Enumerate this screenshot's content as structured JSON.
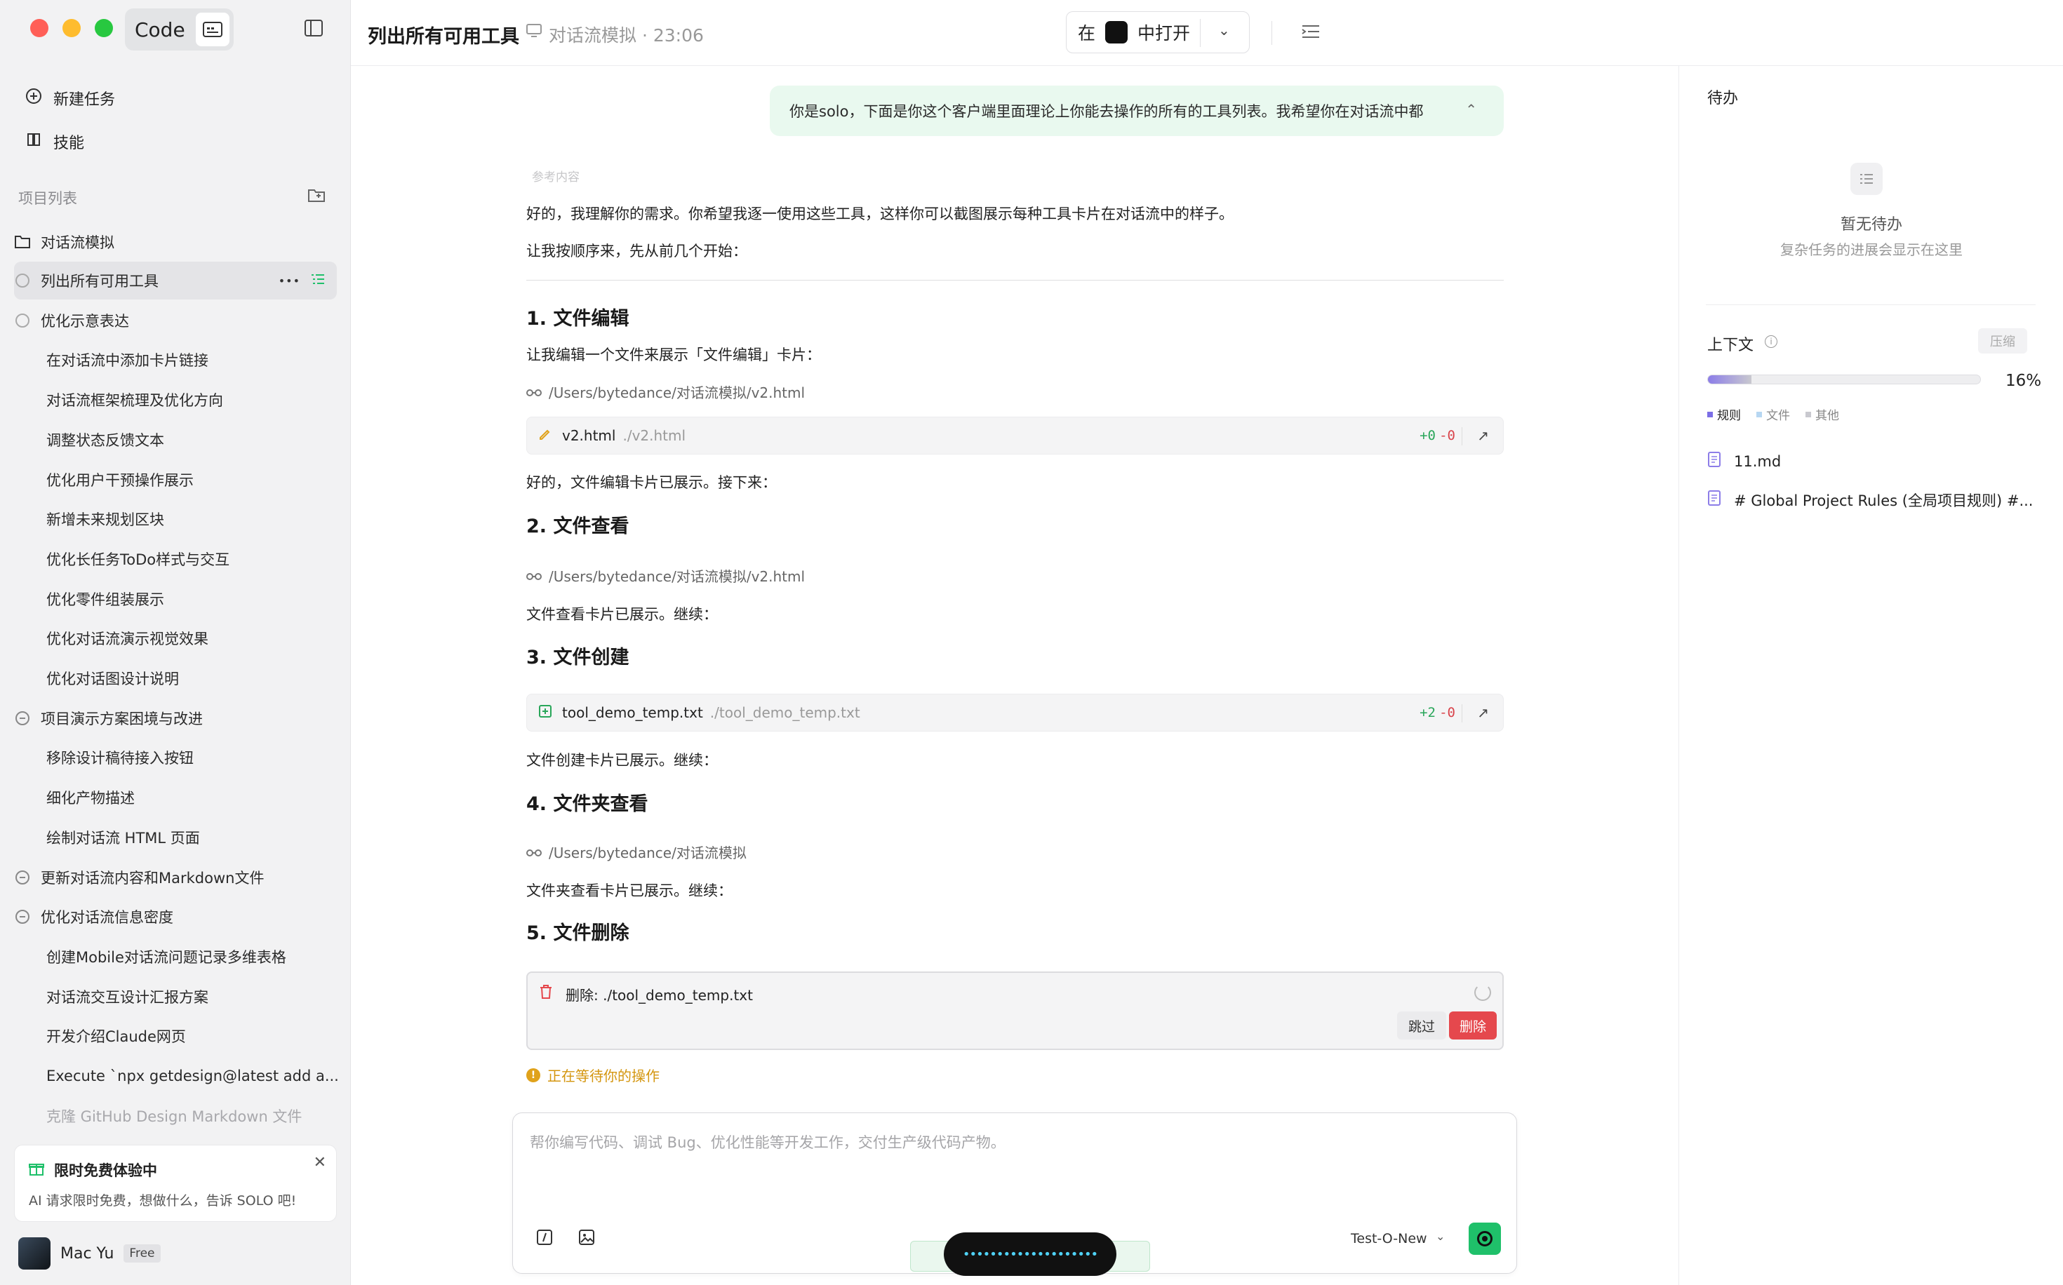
{
  "window": {
    "app_name": "Code"
  },
  "sidebar": {
    "new_task": "新建任务",
    "skills": "技能",
    "projects_label": "项目列表",
    "project_name": "对话流模拟",
    "tasks": [
      {
        "label": "列出所有可用工具",
        "type": "spinner",
        "active": true
      },
      {
        "label": "优化示意表达",
        "type": "spinner"
      },
      {
        "label": "在对话流中添加卡片链接",
        "type": "child"
      },
      {
        "label": "对话流框架梳理及优化方向",
        "type": "child"
      },
      {
        "label": "调整状态反馈文本",
        "type": "child"
      },
      {
        "label": "优化用户干预操作展示",
        "type": "child"
      },
      {
        "label": "新增未来规划区块",
        "type": "child"
      },
      {
        "label": "优化长任务ToDo样式与交互",
        "type": "child"
      },
      {
        "label": "优化零件组装展示",
        "type": "child"
      },
      {
        "label": "优化对话流演示视觉效果",
        "type": "child"
      },
      {
        "label": "优化对话图设计说明",
        "type": "child"
      },
      {
        "label": "项目演示方案困境与改进",
        "type": "group"
      },
      {
        "label": "移除设计稿待接入按钮",
        "type": "child"
      },
      {
        "label": "细化产物描述",
        "type": "child"
      },
      {
        "label": "绘制对话流 HTML 页面",
        "type": "child"
      },
      {
        "label": "更新对话流内容和Markdown文件",
        "type": "group"
      },
      {
        "label": "优化对话流信息密度",
        "type": "group"
      },
      {
        "label": "创建Mobile对话流问题记录多维表格",
        "type": "child"
      },
      {
        "label": "对话流交互设计汇报方案",
        "type": "child"
      },
      {
        "label": "开发介绍Claude网页",
        "type": "child"
      },
      {
        "label": "Execute `npx getdesign@latest add a...",
        "type": "child"
      },
      {
        "label": "克隆 GitHub Design Markdown 文件",
        "type": "child-faded"
      }
    ],
    "promo": {
      "title": "限时免费体验中",
      "desc": "AI 请求限时免费，想做什么，告诉 SOLO 吧!"
    },
    "user": {
      "name": "Mac Yu",
      "plan": "Free"
    }
  },
  "header": {
    "title": "列出所有可用工具",
    "meta": "对话流模拟 · 23:06",
    "open_in_prefix": "在",
    "open_in_suffix": "中打开"
  },
  "chat": {
    "user_message": "你是solo，下面是你这个客户端里面理论上你能去操作的所有的工具列表。我希望你在对话流中都",
    "ref_label": "参考内容",
    "intro1": "好的，我理解你的需求。你希望我逐一使用这些工具，这样你可以截图展示每种工具卡片在对话流中的样子。",
    "intro2": "让我按顺序来，先从前几个开始：",
    "s1_title": "1. 文件编辑",
    "s1_desc": "让我编辑一个文件来展示「文件编辑」卡片：",
    "s1_path": "/Users/bytedance/对话流模拟/v2.html",
    "s1_card": {
      "name": "v2.html",
      "path": "./v2.html",
      "plus": "+0",
      "minus": "-0"
    },
    "s1_after": "好的，文件编辑卡片已展示。接下来：",
    "s2_title": "2. 文件查看",
    "s2_path": "/Users/bytedance/对话流模拟/v2.html",
    "s2_after": "文件查看卡片已展示。继续：",
    "s3_title": "3. 文件创建",
    "s3_card": {
      "name": "tool_demo_temp.txt",
      "path": "./tool_demo_temp.txt",
      "plus": "+2",
      "minus": "-0"
    },
    "s3_after": "文件创建卡片已展示。继续：",
    "s4_title": "4. 文件夹查看",
    "s4_path": "/Users/bytedance/对话流模拟",
    "s4_after": "文件夹查看卡片已展示。继续：",
    "s5_title": "5. 文件删除",
    "delete_label": "删除: ./tool_demo_temp.txt",
    "skip_btn": "跳过",
    "delete_btn": "删除",
    "waiting": "正在等待你的操作"
  },
  "composer": {
    "placeholder": "帮你编写代码、调试 Bug、优化性能等开发工作，交付生产级代码产物。",
    "model": "Test-O-New"
  },
  "right": {
    "todo_title": "待办",
    "todo_empty": "暂无待办",
    "todo_hint": "复杂任务的进展会显示在这里",
    "context_title": "上下文",
    "compress_btn": "压缩",
    "context_percent": "16%",
    "context_fill": 0.16,
    "legend": [
      "规则",
      "文件",
      "其他"
    ],
    "files": [
      "11.md",
      "# Global Project Rules (全局项目规则) #..."
    ]
  },
  "colors": {
    "accent_green": "#1fc06a",
    "danger_red": "#e5484d",
    "warning_orange": "#e0a21b"
  }
}
